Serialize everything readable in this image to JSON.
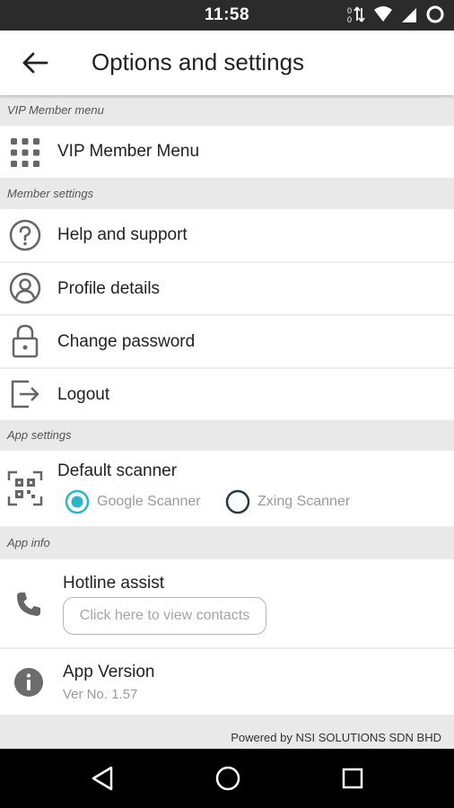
{
  "status_bar": {
    "time": "11:58"
  },
  "app_bar": {
    "title": "Options and settings"
  },
  "sections": {
    "vip": {
      "header": "VIP Member menu",
      "item": "VIP Member Menu"
    },
    "member": {
      "header": "Member settings",
      "items": [
        "Help and support",
        "Profile details",
        "Change password",
        "Logout"
      ]
    },
    "app": {
      "header": "App settings",
      "scanner_title": "Default scanner",
      "options": [
        "Google Scanner",
        "Zxing Scanner"
      ],
      "selected": "Google Scanner"
    },
    "info": {
      "header": "App info",
      "hotline_title": "Hotline assist",
      "hotline_button": "Click here to view contacts",
      "version_title": "App Version",
      "version_value": "Ver No. 1.57"
    }
  },
  "footer": {
    "powered_by": "Powered by NSI SOLUTIONS SDN BHD"
  },
  "colors": {
    "accent": "#2ab5c9",
    "status_bar": "#2b2b2b",
    "nav_bar": "#000000"
  },
  "icons": [
    "back-arrow-icon",
    "grid-icon",
    "help-icon",
    "profile-icon",
    "lock-icon",
    "logout-icon",
    "qr-scan-icon",
    "phone-icon",
    "info-icon"
  ]
}
